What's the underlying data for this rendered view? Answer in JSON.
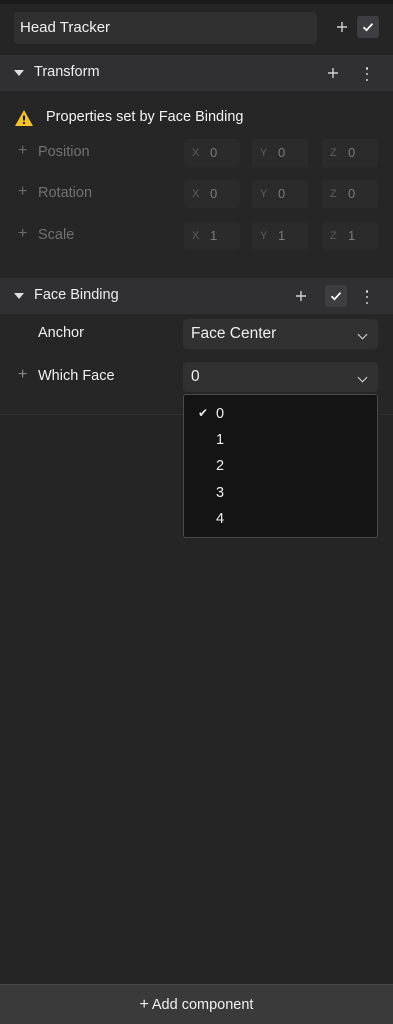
{
  "header": {
    "object_name": "Head Tracker",
    "add_icon": "plus-icon",
    "enabled_icon": "checkmark-icon"
  },
  "transform": {
    "title": "Transform",
    "warning_icon": "warning-icon",
    "warning_text": "Properties set by Face Binding",
    "properties": [
      {
        "label": "Position",
        "x": "0",
        "y": "0",
        "z": "0"
      },
      {
        "label": "Rotation",
        "x": "0",
        "y": "0",
        "z": "0"
      },
      {
        "label": "Scale",
        "x": "1",
        "y": "1",
        "z": "1"
      }
    ],
    "axes": {
      "x": "X",
      "y": "Y",
      "z": "Z"
    }
  },
  "face_binding": {
    "title": "Face Binding",
    "anchor_label": "Anchor",
    "anchor_value": "Face Center",
    "which_face_label": "Which Face",
    "which_face_value": "0",
    "options": [
      "0",
      "1",
      "2",
      "3",
      "4"
    ],
    "selected_option": "0"
  },
  "footer": {
    "add_component_label": "Add component"
  },
  "colors": {
    "background": "#252526",
    "header_bg": "#303032",
    "warning": "#f2c12e",
    "menu_bg": "#141414"
  }
}
